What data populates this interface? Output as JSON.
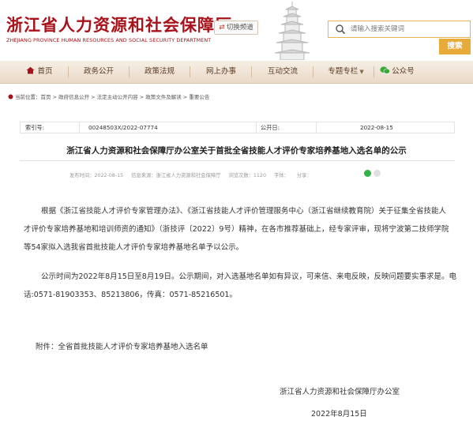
{
  "header": {
    "title_cn": "浙江省人力资源和社会保障厅",
    "title_en": "ZHEJIANG PROVINCE HUMAN RESOURCES AND SOCIAL SECURITY DEPARTMENT",
    "switch_label": "切换频道",
    "search_placeholder": "请输入搜索关键词",
    "search_button": "搜索"
  },
  "nav": {
    "items": [
      {
        "label": "首页",
        "icon": "home-icon"
      },
      {
        "label": "政务公开"
      },
      {
        "label": "政策法规"
      },
      {
        "label": "网上办事"
      },
      {
        "label": "互动交流"
      },
      {
        "label": "专题专栏",
        "icon": "chevron-down-icon"
      },
      {
        "label": "公众号",
        "icon": "wechat-icon"
      }
    ]
  },
  "breadcrumb": {
    "text": "当前位置：首页 > 政府信息公开 > 法定主动公开内容 > 政策文件及解读 > 重要公告"
  },
  "meta": {
    "index_label": "索引号:",
    "index_value": "00248503X/2022-07774",
    "publish_label": "公开日:",
    "publish_value": "2022-08-15"
  },
  "article": {
    "title": "浙江省人力资源和社会保障厅办公室关于首批全省技能人才评价专家培养基地入选名单的公示",
    "publish_date": "发布时间：2022-08-15",
    "source": "信息来源：浙江省人力资源和社会保障厅",
    "views": "浏览次数：1120",
    "font_label": "字体：",
    "share_label": "分享：",
    "p1_lines": [
      "根据《浙江省技能人才评价专家管理办法》、《浙江省技能人才评价管理服务中心（浙江省继续教育院）关于征集全省技能人",
      "才评价专家培养基地和培训师资的通知》（浙技评〔2022〕9号）精神，在各市推荐基础上，经专家评审，现将宁波第二技师学院",
      "等54家拟入选我省首批技能人才评价专家培养基地名单予以公示。"
    ],
    "p2_lines": [
      "公示时间为2022年8月15日至8月19日。公示期间，对入选基地名单如有异议，可来信、来电反映，反映问题要实事求是。电",
      "话:0571-81903353、85213806，传真：0571-85216501。"
    ],
    "attachment": "附件：全省首批技能人才评价专家培养基地入选名单",
    "signature": "浙江省人力资源和社会保障厅办公室",
    "date": "2022年8月15日"
  },
  "colors": {
    "brand_red": "#a8121a",
    "search_orange": "#e8ab3a",
    "nav_bg": "#ead9c6"
  }
}
